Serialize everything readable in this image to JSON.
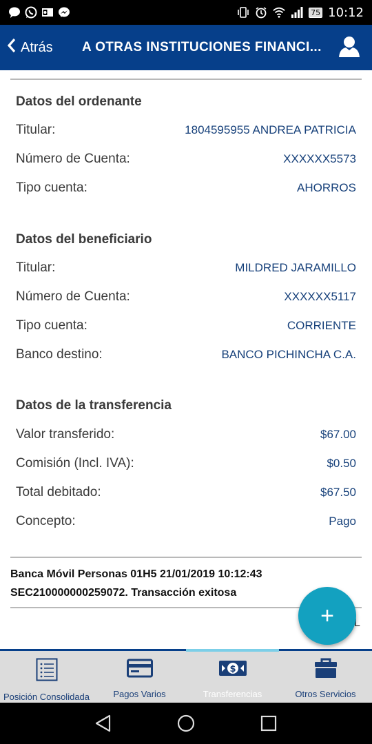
{
  "status_bar": {
    "battery": "75",
    "time": "10:12",
    "icons_left": [
      "message-icon",
      "whatsapp-icon",
      "outlook-icon",
      "messenger-icon"
    ],
    "icons_right": [
      "vibrate-icon",
      "alarm-icon",
      "wifi-icon",
      "signal-icon",
      "battery-icon"
    ]
  },
  "app_bar": {
    "back_label": "Atrás",
    "title": "A OTRAS INSTITUCIONES FINANCI...",
    "color": "#063f8a"
  },
  "ordenante": {
    "title": "Datos del ordenante",
    "rows": [
      {
        "label": "Titular:",
        "value": "1804595955 ANDREA PATRICIA"
      },
      {
        "label": "Número de Cuenta:",
        "value": "XXXXXX5573"
      },
      {
        "label": "Tipo cuenta:",
        "value": "AHORROS"
      }
    ]
  },
  "beneficiario": {
    "title": "Datos del beneficiario",
    "rows": [
      {
        "label": "Titular:",
        "value": "MILDRED JARAMILLO"
      },
      {
        "label": "Número de Cuenta:",
        "value": "XXXXXX5117"
      },
      {
        "label": "Tipo cuenta:",
        "value": "CORRIENTE"
      },
      {
        "label": "Banco destino:",
        "value": "BANCO PICHINCHA C.A."
      }
    ]
  },
  "transferencia": {
    "title": "Datos de la transferencia",
    "rows": [
      {
        "label": "Valor transferido:",
        "value": "$67.00"
      },
      {
        "label": "Comisión (Incl. IVA):",
        "value": "$0.50"
      },
      {
        "label": "Total debitado:",
        "value": "$67.50"
      },
      {
        "label": "Concepto:",
        "value": "Pago"
      }
    ]
  },
  "footer": {
    "line1": "Banca Móvil Personas 01H5 21/01/2019 10:12:43",
    "line2": "SEC210000000259072. Transacción exitosa",
    "trailing": "L"
  },
  "fab": {
    "label": "+",
    "color": "#13a1c0"
  },
  "bottom_nav": {
    "items": [
      {
        "label": "Posición Consolidada",
        "icon": "list-icon"
      },
      {
        "label": "Pagos Varios",
        "icon": "card-icon"
      },
      {
        "label": "Transferencias",
        "icon": "money-icon"
      },
      {
        "label": "Otros Servicios",
        "icon": "briefcase-icon"
      }
    ],
    "active_index": 2
  },
  "system_nav": {
    "buttons": [
      "back-triangle-icon",
      "home-circle-icon",
      "recents-square-icon"
    ]
  }
}
